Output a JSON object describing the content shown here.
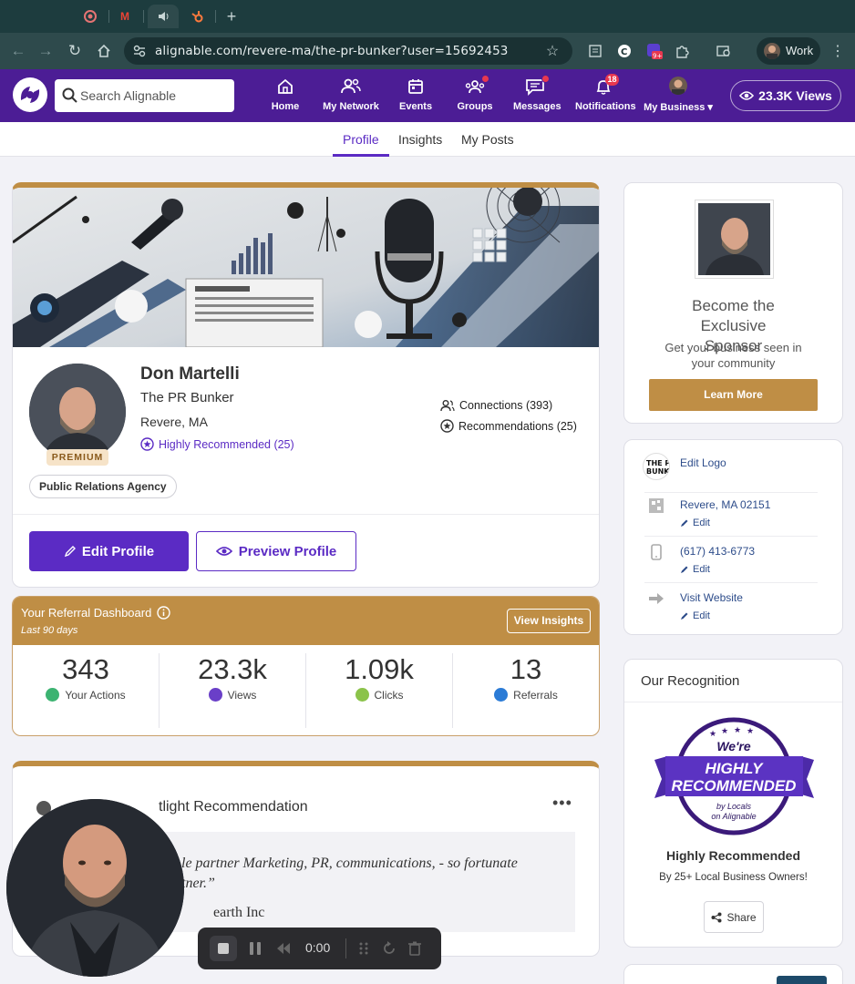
{
  "browser": {
    "url": "alignable.com/revere-ma/the-pr-bunker?user=15692453",
    "profile_label": "Work",
    "ext_badge": "9+"
  },
  "nav": {
    "search_placeholder": "Search Alignable",
    "items": [
      {
        "label": "Home",
        "icon": "home-icon"
      },
      {
        "label": "My Network",
        "icon": "network-icon"
      },
      {
        "label": "Events",
        "icon": "calendar-icon"
      },
      {
        "label": "Groups",
        "icon": "groups-icon"
      },
      {
        "label": "Messages",
        "icon": "message-icon"
      },
      {
        "label": "Notifications",
        "icon": "bell-icon",
        "badge": "18"
      },
      {
        "label": "My Business",
        "icon": "avatar"
      }
    ],
    "views": "23.3K Views"
  },
  "subtabs": [
    "Profile",
    "Insights",
    "My Posts"
  ],
  "profile": {
    "name": "Don Martelli",
    "business": "The PR Bunker",
    "location": "Revere, MA",
    "highly_recommended": "Highly Recommended (25)",
    "premium": "PREMIUM",
    "connections": "Connections (393)",
    "recommendations": "Recommendations (25)",
    "category": "Public Relations Agency",
    "edit_label": "Edit Profile",
    "preview_label": "Preview Profile"
  },
  "referral": {
    "title": "Your Referral Dashboard",
    "subtitle": "Last 90 days",
    "button": "View Insights",
    "stats": [
      {
        "value": "343",
        "label": "Your Actions",
        "color": "#3cb371"
      },
      {
        "value": "23.3k",
        "label": "Views",
        "color": "#6a3fc8"
      },
      {
        "value": "1.09k",
        "label": "Clicks",
        "color": "#8bc34a"
      },
      {
        "value": "13",
        "label": "Referrals",
        "color": "#2b7bd6"
      }
    ]
  },
  "spotlight": {
    "title": "Our Spotlight Recommendation",
    "title_visible": "tlight Recommendation",
    "quote_line1": "le partner Marketing, PR, communications, - so fortunate",
    "quote_line2": "tner.”",
    "author": "earth Inc"
  },
  "sponsor": {
    "title": "Become the Exclusive Sponsor",
    "subtitle": "Get your business seen in your community",
    "button": "Learn More"
  },
  "contact": {
    "logo_label": "Edit Logo",
    "address": "Revere, MA 02151",
    "phone": "(617) 413-6773",
    "website": "Visit Website",
    "edit": "Edit"
  },
  "recognition": {
    "title": "Our Recognition",
    "seal_top": "We're",
    "seal_main1": "HIGHLY",
    "seal_main2": "RECOMMENDED",
    "seal_by1": "by Locals",
    "seal_by2": "on Alignable",
    "heading": "Highly Recommended",
    "sub": "By 25+ Local Business Owners!",
    "share": "Share"
  },
  "recorder": {
    "time": "0:00"
  },
  "colors": {
    "brand_purple": "#4c1d95",
    "accent_purple": "#5b2bc4",
    "gold": "#bf8e45"
  }
}
